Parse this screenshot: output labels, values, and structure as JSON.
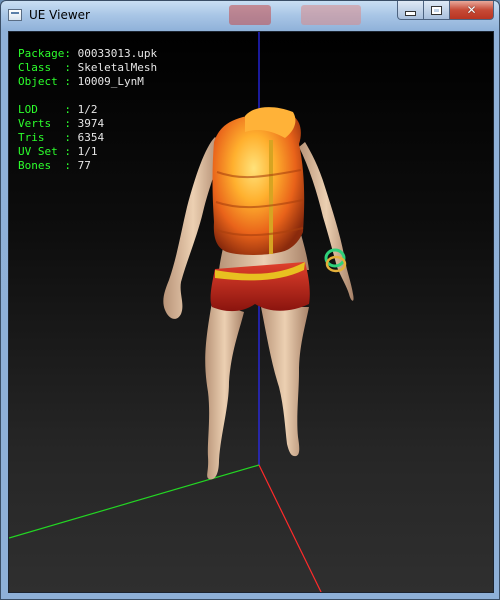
{
  "window": {
    "title": "UE Viewer",
    "buttons": {
      "minimize": "minimize",
      "maximize": "maximize",
      "close": "close"
    }
  },
  "info": {
    "package_label": "Package:",
    "package_value": "00033013.upk",
    "class_label": "Class  :",
    "class_value": "SkeletalMesh",
    "object_label": "Object :",
    "object_value": "10009_LynM",
    "lod_label": "LOD    :",
    "lod_value": "1/2",
    "verts_label": "Verts  :",
    "verts_value": "3974",
    "tris_label": "Tris   :",
    "tris_value": "6354",
    "uvset_label": "UV Set :",
    "uvset_value": "1/1",
    "bones_label": "Bones  :",
    "bones_value": "77"
  },
  "colors": {
    "info_key": "#2cff2c",
    "info_value": "#e6e6e6",
    "axis_x": "#ff2a2a",
    "axis_y": "#23d623",
    "axis_z": "#2b2bff",
    "vest": "#f08a1c",
    "shorts": "#c0201a",
    "skin": "#e2c2a3"
  },
  "icons": [
    "app-icon",
    "minimize-icon",
    "maximize-icon",
    "close-icon"
  ]
}
